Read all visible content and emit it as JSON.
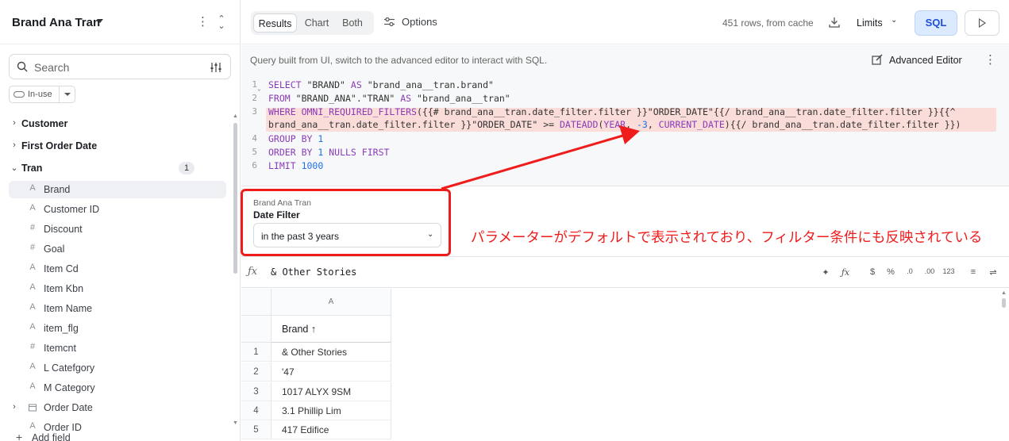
{
  "sidebar": {
    "title": "Brand Ana Tran",
    "search_placeholder": "Search",
    "in_use_label": "In-use",
    "groups": [
      {
        "label": "Customer"
      },
      {
        "label": "First Order Date"
      },
      {
        "label": "Tran",
        "count": "1"
      }
    ],
    "fields": [
      {
        "label": "Brand",
        "type_icon": "A",
        "selected": true
      },
      {
        "label": "Customer ID",
        "type_icon": "A"
      },
      {
        "label": "Discount",
        "type_icon": "#"
      },
      {
        "label": "Goal",
        "type_icon": "#"
      },
      {
        "label": "Item Cd",
        "type_icon": "A"
      },
      {
        "label": "Item Kbn",
        "type_icon": "A"
      },
      {
        "label": "Item Name",
        "type_icon": "A"
      },
      {
        "label": "item_flg",
        "type_icon": "A"
      },
      {
        "label": "Itemcnt",
        "type_icon": "#"
      },
      {
        "label": "L Catefgory",
        "type_icon": "A"
      },
      {
        "label": "M Category",
        "type_icon": "A"
      },
      {
        "label": "Order Date",
        "type_icon": "calendar-icon"
      },
      {
        "label": "Order ID",
        "type_icon": "A"
      }
    ],
    "add_field_label": "Add field"
  },
  "toolbar": {
    "tabs": [
      "Results",
      "Chart",
      "Both"
    ],
    "active_tab": "Results",
    "options_label": "Options",
    "rows_status": "451 rows, from cache",
    "limits_label": "Limits",
    "sql_label": "SQL"
  },
  "editor": {
    "notice": "Query built from UI, switch to the advanced editor to interact with SQL.",
    "advanced_editor_label": "Advanced Editor",
    "line_numbers": [
      "1",
      "2",
      "3",
      "4",
      "5",
      "6"
    ],
    "lines": [
      "SELECT \"BRAND\" AS \"brand_ana__tran.brand\"",
      "FROM \"BRAND_ANA\".\"TRAN\" AS \"brand_ana__tran\"",
      "WHERE OMNI_REQUIRED_FILTERS({{# brand_ana__tran.date_filter.filter }}\"ORDER_DATE\"{{/ brand_ana__tran.date_filter.filter }}{{^",
      "brand_ana__tran.date_filter.filter }}\"ORDER_DATE\" >= DATEADD(YEAR, -3, CURRENT_DATE){{/ brand_ana__tran.date_filter.filter }})",
      "GROUP BY 1",
      "ORDER BY 1 NULLS FIRST",
      "LIMIT 1000"
    ]
  },
  "filter": {
    "group_label": "Brand Ana Tran",
    "name": "Date Filter",
    "value": "in the past 3 years"
  },
  "annotation": {
    "text": "パラメーターがデフォルトで表示されており、フィルター条件にも反映されている",
    "color": "#ef1c1c"
  },
  "formula_bar": {
    "value": "& Other Stories"
  },
  "grid": {
    "column_letter": "A",
    "column_header": "Brand ↑",
    "rows": [
      {
        "n": "1",
        "brand": "& Other Stories"
      },
      {
        "n": "2",
        "brand": "'47"
      },
      {
        "n": "3",
        "brand": "1017 ALYX 9SM"
      },
      {
        "n": "4",
        "brand": "3.1 Phillip Lim"
      },
      {
        "n": "5",
        "brand": "417 Edifice"
      }
    ]
  },
  "colors": {
    "accent": "#1d4ed8",
    "sql_button_bg": "#dbeafe",
    "highlight": "#fadcd9"
  }
}
